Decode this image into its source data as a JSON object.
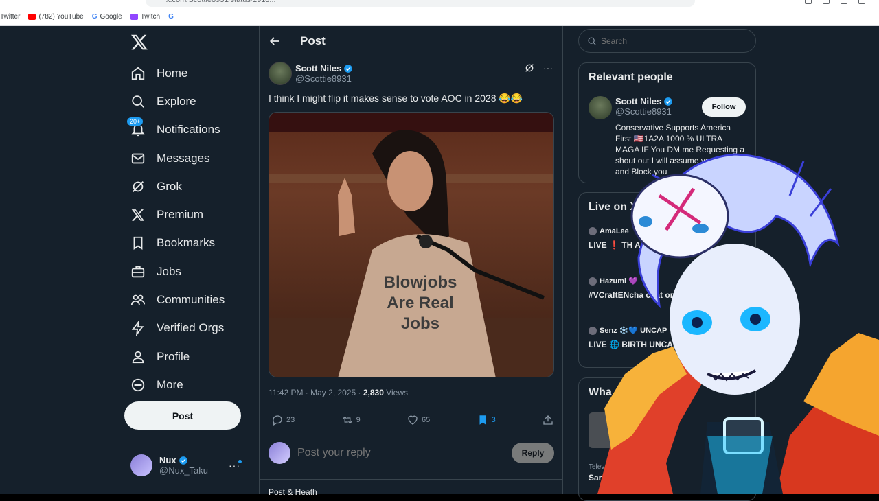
{
  "browser": {
    "url": "x.com/Scottie8931/status/1918...",
    "bookmarks": [
      {
        "label": "Twitter",
        "color": "#ffffff"
      },
      {
        "label": "(782) YouTube",
        "color": "#ff0000"
      },
      {
        "label": "Google",
        "color": "#4285f4"
      },
      {
        "label": "Twitch",
        "color": "#9146ff"
      },
      {
        "label": "G",
        "color": "#4285f4"
      }
    ]
  },
  "sidebar": {
    "logo": "x-logo-icon",
    "items": [
      {
        "label": "Home",
        "icon": "home-icon"
      },
      {
        "label": "Explore",
        "icon": "search-icon"
      },
      {
        "label": "Notifications",
        "icon": "bell-icon",
        "badge": "20+"
      },
      {
        "label": "Messages",
        "icon": "mail-icon"
      },
      {
        "label": "Grok",
        "icon": "grok-icon"
      },
      {
        "label": "Premium",
        "icon": "x-icon"
      },
      {
        "label": "Bookmarks",
        "icon": "bookmark-icon"
      },
      {
        "label": "Jobs",
        "icon": "briefcase-icon"
      },
      {
        "label": "Communities",
        "icon": "people-icon"
      },
      {
        "label": "Verified Orgs",
        "icon": "bolt-icon"
      },
      {
        "label": "Profile",
        "icon": "person-icon"
      },
      {
        "label": "More",
        "icon": "more-circle-icon"
      }
    ],
    "post_button": "Post",
    "account": {
      "name": "Nux",
      "handle": "@Nux_Taku",
      "more": "···"
    }
  },
  "main": {
    "title": "Post",
    "tweet": {
      "name": "Scott Niles",
      "handle": "@Scottie8931",
      "text": "I think I might flip it makes sense to vote AOC in 2028 😂😂",
      "image_caption": "Blowjobs Are Real Jobs",
      "caption_lines": [
        "Blowjobs",
        "Are Real",
        "Jobs"
      ],
      "timestamp": "11:42 PM · May 2, 2025 · ",
      "views_count": "2,830",
      "views_label": " Views",
      "stats": {
        "replies": "23",
        "reposts": "9",
        "likes": "65",
        "bookmarks": "3"
      }
    },
    "reply": {
      "placeholder": "Post your reply",
      "button": "Reply"
    },
    "next_reply": "Post & Heath"
  },
  "right": {
    "search_placeholder": "Search",
    "relevant": {
      "title": "Relevant people",
      "name": "Scott Niles",
      "handle": "@Scottie8931",
      "follow": "Follow",
      "bio": "Conservative Supports America First 🇺🇸1A2A 1000 % ULTRA MAGA IF You DM me Requesting a shout out I will assume you A bot and Block you"
    },
    "live": {
      "title": "Live on X",
      "items": [
        {
          "user": "AmaLee",
          "text": "LIVE ❗ TH ARRIVED 💙"
        },
        {
          "user": "Hazumi 💜",
          "text": "#VCraftENcha chat on twitch"
        },
        {
          "user": "Senz ❄️💙 UNCAP",
          "text": "LIVE 🌐 BIRTH UNCAPPED S"
        }
      ]
    },
    "whats": {
      "title": "Wha",
      "source": "Telev",
      "headline": "Sar"
    }
  },
  "colors": {
    "background": "#15202b",
    "accent": "#1d9bf0",
    "border": "#38444d",
    "muted": "#8b98a5"
  }
}
